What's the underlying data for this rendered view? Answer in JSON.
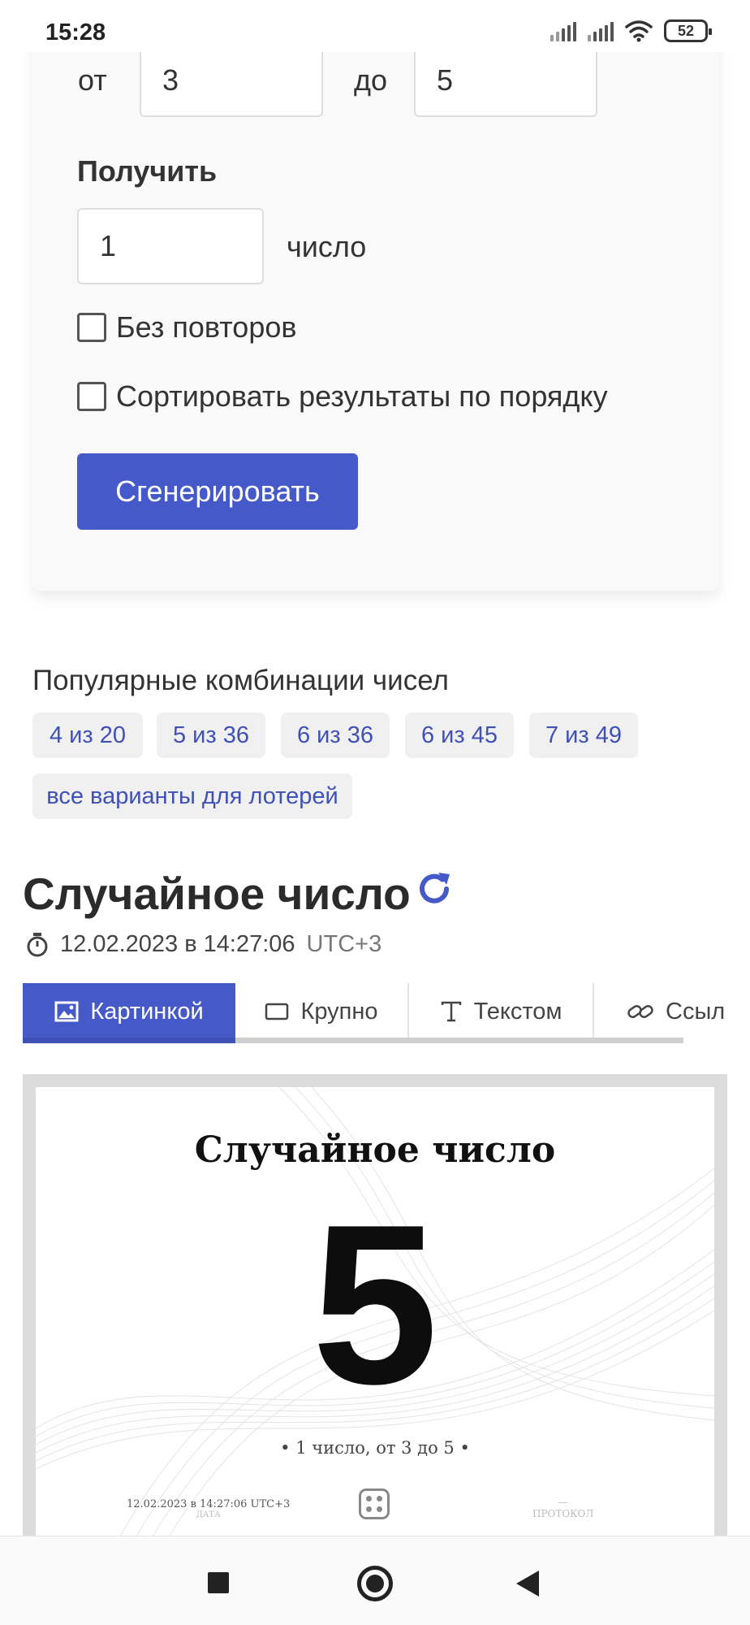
{
  "status_bar": {
    "time": "15:28",
    "battery": "52",
    "icons": [
      "signal-icon",
      "signal-icon",
      "wifi-icon",
      "battery-icon"
    ]
  },
  "form": {
    "from_label": "от",
    "from_value": "3",
    "to_label": "до",
    "to_value": "5",
    "get_label": "Получить",
    "count_value": "1",
    "count_unit": "число",
    "no_repeats_label": "Без повторов",
    "no_repeats_checked": false,
    "sort_label": "Сортировать результаты по порядку",
    "sort_checked": false,
    "generate_button": "Сгенерировать"
  },
  "popular": {
    "title": "Популярные комбинации чисел",
    "chips": [
      "4 из 20",
      "5 из 36",
      "6 из 36",
      "6 из 45",
      "7 из 49"
    ],
    "all_variants": "все варианты для лотерей"
  },
  "result": {
    "title": "Случайное число",
    "date": "12.02.2023 в 14:27:06",
    "timezone": "UTC+3",
    "tabs": [
      {
        "label": "Картинкой",
        "icon": "image-icon",
        "active": true
      },
      {
        "label": "Крупно",
        "icon": "rectangle-icon",
        "active": false
      },
      {
        "label": "Текстом",
        "icon": "text-icon",
        "active": false
      },
      {
        "label": "Ссыл",
        "icon": "link-icon",
        "active": false
      }
    ],
    "preview": {
      "title": "Случайное число",
      "number": "5",
      "caption": "•  1 число, от 3 до 5  •",
      "footer_date": "12.02.2023 в 14:27:06 UTC+3",
      "footer_date_label": "ДАТА",
      "footer_protocol_value": "—",
      "footer_protocol_label": "ПРОТОКОЛ"
    }
  },
  "colors": {
    "accent": "#4659c8",
    "link": "#3f51b5",
    "chip_bg": "#f0f0f0",
    "card_bg": "#f9f9f9"
  }
}
